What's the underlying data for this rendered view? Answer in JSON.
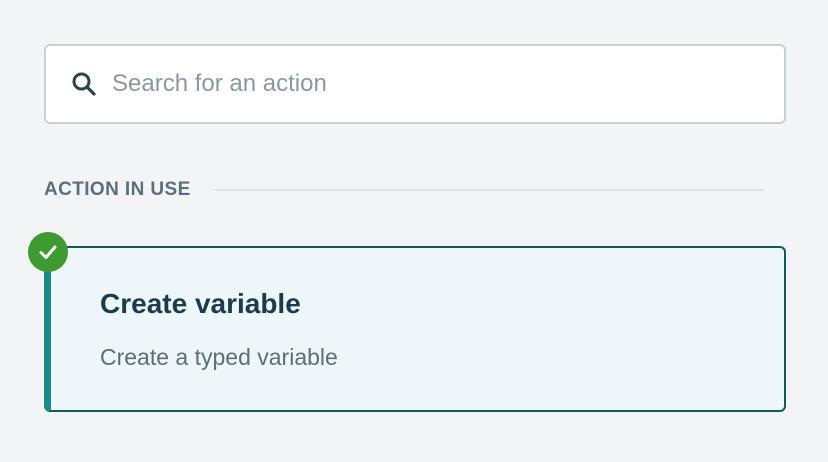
{
  "search": {
    "placeholder": "Search for an action",
    "value": "",
    "icon": "search-icon"
  },
  "section": {
    "title": "ACTION IN USE"
  },
  "action_card": {
    "title": "Create variable",
    "description": "Create a typed variable",
    "status_icon": "check-circle-icon",
    "colors": {
      "accent": "#188a8c",
      "border": "#0f5b5e",
      "background": "#edf6f9",
      "check": "#3c9a2e"
    }
  }
}
